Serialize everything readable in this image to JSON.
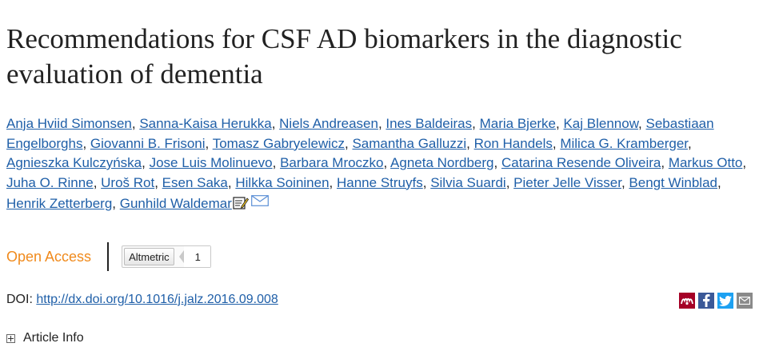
{
  "article": {
    "title": "Recommendations for CSF AD biomarkers in the diagnostic evaluation of dementia",
    "authors": [
      "Anja Hviid Simonsen",
      "Sanna-Kaisa Herukka",
      "Niels Andreasen",
      "Ines Baldeiras",
      "Maria Bjerke",
      "Kaj Blennow",
      "Sebastiaan Engelborghs",
      "Giovanni B. Frisoni",
      "Tomasz Gabryelewicz",
      "Samantha Galluzzi",
      "Ron Handels",
      "Milica G. Kramberger",
      "Agnieszka Kulczyńska",
      "Jose Luis Molinuevo",
      "Barbara Mroczko",
      "Agneta Nordberg",
      "Catarina Resende Oliveira",
      "Markus Otto",
      "Juha O. Rinne",
      "Uroš Rot",
      "Esen Saka",
      "Hilkka Soininen",
      "Hanne Struyfs",
      "Silvia Suardi",
      "Pieter Jelle Visser",
      "Bengt Winblad",
      "Henrik Zetterberg",
      "Gunhild Waldemar"
    ],
    "open_access_label": "Open Access",
    "altmetric": {
      "label": "Altmetric",
      "count": "1"
    },
    "doi_label": "DOI:",
    "doi_link": "http://dx.doi.org/10.1016/j.jalz.2016.09.008",
    "article_info_label": "Article Info"
  },
  "icons": {
    "corresponding_note": "note-pencil-icon",
    "email": "envelope-icon",
    "share": [
      "mendeley-icon",
      "facebook-icon",
      "twitter-icon",
      "email-icon"
    ]
  },
  "colors": {
    "link": "#1f5fa8",
    "open_access": "#f08a1c",
    "mendeley": "#a50026",
    "facebook": "#3b5998",
    "twitter": "#1da1f2",
    "email": "#8a8a8a"
  }
}
